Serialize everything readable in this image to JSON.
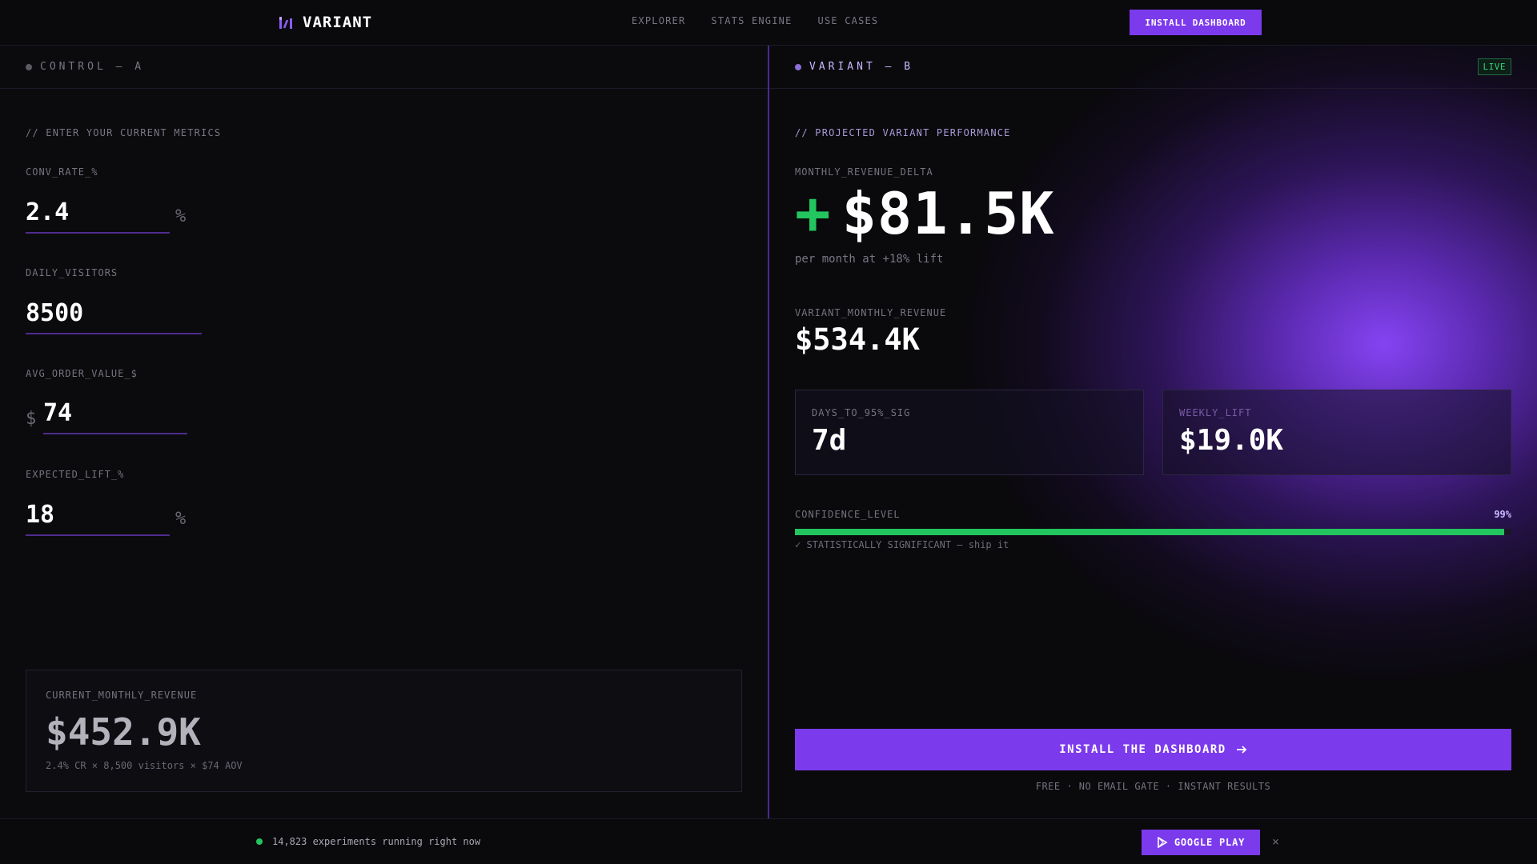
{
  "colors": {
    "accent": "#7c3aed",
    "positive": "#22c55e",
    "control_dot": "#6b6875",
    "variant_dot": "#8b6fd6",
    "background": "#0a090c"
  },
  "header": {
    "brand": "VARIANT",
    "brand_icon": "bar-chart-icon",
    "nav": [
      "EXPLORER",
      "STATS ENGINE",
      "USE CASES"
    ],
    "cta": "INSTALL DASHBOARD"
  },
  "control": {
    "title": "CONTROL — A",
    "comment": "// ENTER YOUR CURRENT METRICS",
    "fields": [
      {
        "label": "CONV_RATE_%",
        "value": "2.4",
        "suffix": "%"
      },
      {
        "label": "DAILY_VISITORS",
        "value": "8500"
      },
      {
        "label": "AVG_ORDER_VALUE_$",
        "value": "74",
        "prefix": "$"
      },
      {
        "label": "EXPECTED_LIFT_%",
        "value": "18",
        "suffix": "%"
      }
    ],
    "revenue": {
      "label": "CURRENT_MONTHLY_REVENUE",
      "value": "$452.9K",
      "formula": "2.4% CR × 8,500 visitors × $74 AOV"
    }
  },
  "variant": {
    "title": "VARIANT — B",
    "badge": "LIVE",
    "comment": "// PROJECTED VARIANT PERFORMANCE",
    "delta": {
      "label": "MONTHLY_REVENUE_DELTA",
      "sign": "+",
      "value": "$81.5K",
      "sub": "per month at +18% lift"
    },
    "monthly": {
      "label": "VARIANT_MONTHLY_REVENUE",
      "value": "$534.4K"
    },
    "cards": [
      {
        "label": "DAYS_TO_95%_SIG",
        "value": "7d"
      },
      {
        "label": "WEEKLY_LIFT",
        "value": "$19.0K"
      }
    ],
    "confidence": {
      "label": "CONFIDENCE_LEVEL",
      "percent_text": "99%",
      "fill_fraction": 0.99,
      "note": "✓ STATISTICALLY SIGNIFICANT — ship it"
    },
    "cta": "INSTALL THE DASHBOARD",
    "cta_note": "FREE · NO EMAIL GATE · INSTANT RESULTS"
  },
  "footer": {
    "status": "14,823 experiments running right now",
    "store_button": "GOOGLE PLAY",
    "close": "×"
  }
}
